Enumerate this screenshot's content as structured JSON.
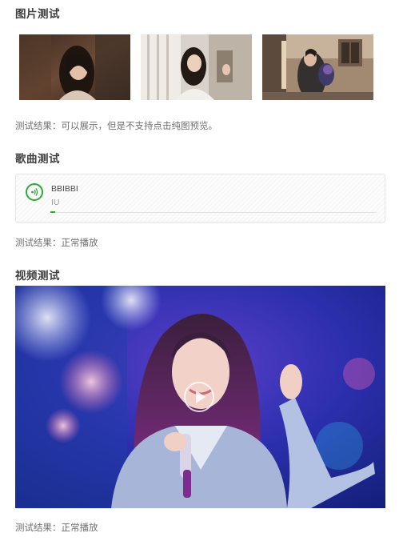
{
  "sections": {
    "images": {
      "title": "图片测试",
      "result": "测试结果：可以展示，但是不支持点击纯图预览。"
    },
    "song": {
      "title": "歌曲测试",
      "song_title": "BBIBBI",
      "artist": "IU",
      "progress": 0.015,
      "result": "测试结果：正常播放"
    },
    "video": {
      "title": "视频测试",
      "result": "测试结果：正常播放"
    }
  },
  "colors": {
    "accent": "#2dab37",
    "title": "#3f3f3f",
    "result": "#6f6f6f"
  },
  "icons": {
    "song_play": "audio-wave-icon",
    "video_play": "play-icon"
  }
}
